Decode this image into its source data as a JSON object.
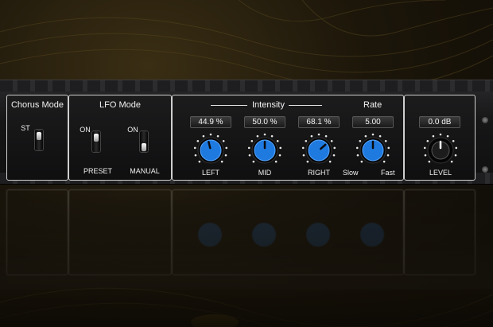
{
  "colors": {
    "accent": "#1f7ae0",
    "panel_border": "#cfcfcf",
    "text": "#f2f2f2"
  },
  "chorus_mode": {
    "title": "Chorus Mode",
    "switch_label": "ST"
  },
  "lfo_mode": {
    "title": "LFO Mode",
    "preset": {
      "on_label": "ON",
      "name": "PRESET"
    },
    "manual": {
      "on_label": "ON",
      "name": "MANUAL"
    }
  },
  "intensity": {
    "title": "Intensity",
    "left": {
      "value": "44.9 %",
      "label": "LEFT",
      "fraction": 0.449
    },
    "mid": {
      "value": "50.0 %",
      "label": "MID",
      "fraction": 0.5
    },
    "right": {
      "value": "68.1 %",
      "label": "RIGHT",
      "fraction": 0.681
    }
  },
  "rate": {
    "title": "Rate",
    "value": "5.00",
    "slow_label": "Slow",
    "fast_label": "Fast",
    "fraction": 0.5
  },
  "level": {
    "value": "0.0 dB",
    "label": "LEVEL",
    "fraction": 0.5
  },
  "icons": [
    "knob-icon",
    "toggle-switch-icon",
    "rack-screw-icon"
  ]
}
